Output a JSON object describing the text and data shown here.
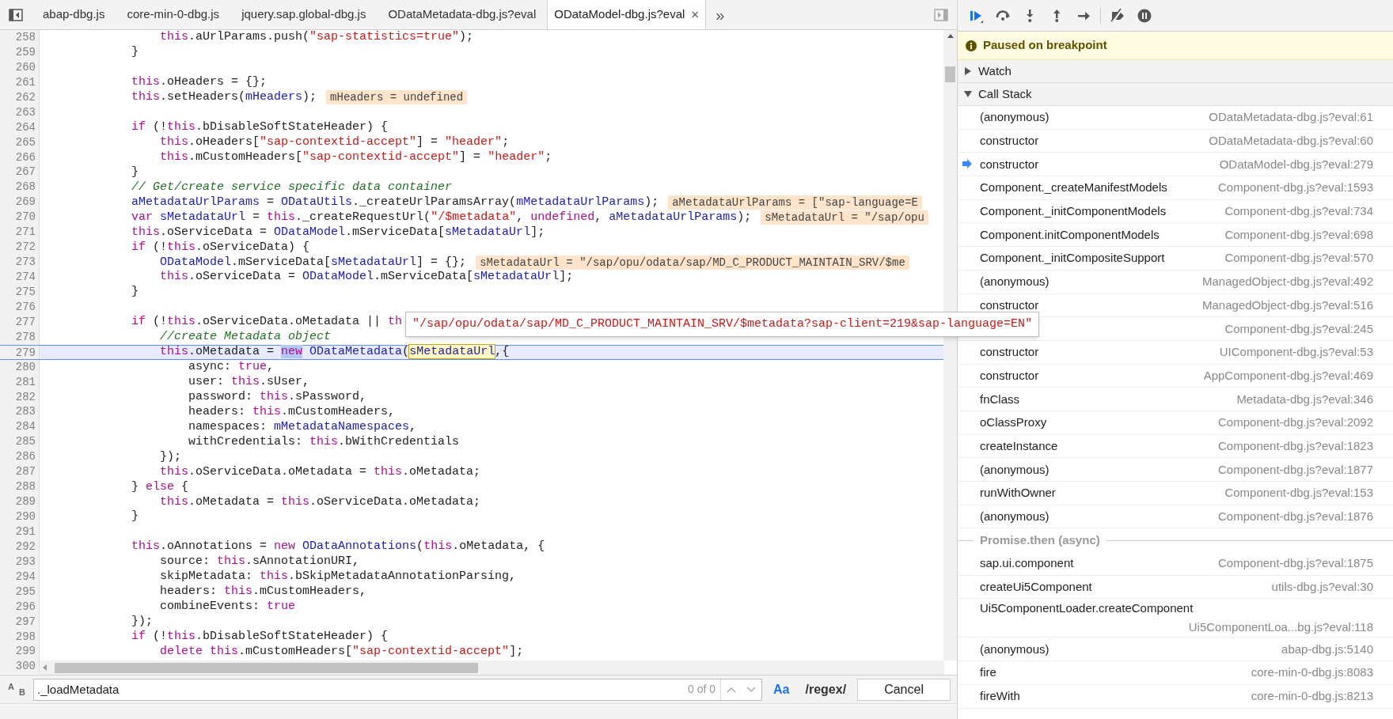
{
  "tabs": [
    {
      "label": "abap-dbg.js",
      "selected": false
    },
    {
      "label": "core-min-0-dbg.js",
      "selected": false
    },
    {
      "label": "jquery.sap.global-dbg.js",
      "selected": false
    },
    {
      "label": "ODataMetadata-dbg.js?eval",
      "selected": false
    },
    {
      "label": "ODataModel-dbg.js?eval",
      "selected": true
    }
  ],
  "tab_overflow": "»",
  "close_glyph": "×",
  "lines": [
    {
      "number": "258",
      "selected": false,
      "tokens": [
        {
          "kind": "keyword",
          "text": "                this"
        },
        {
          "kind": "plain",
          "text": ".aUrlParams.push("
        },
        {
          "kind": "string",
          "text": "\"sap-statistics=true\""
        },
        {
          "kind": "plain",
          "text": ");"
        }
      ]
    },
    {
      "number": "259",
      "selected": false,
      "tokens": [
        {
          "kind": "plain",
          "text": "            }"
        }
      ]
    },
    {
      "number": "260",
      "selected": false
    },
    {
      "number": "261",
      "selected": false,
      "tokens": [
        {
          "kind": "keyword",
          "text": "            this"
        },
        {
          "kind": "plain",
          "text": ".oHeaders = {};"
        }
      ]
    },
    {
      "number": "262",
      "selected": false,
      "tokens": [
        {
          "kind": "keyword",
          "text": "            this"
        },
        {
          "kind": "plain",
          "text": ".setHeaders("
        },
        {
          "kind": "variable",
          "text": "mHeaders"
        },
        {
          "kind": "plain",
          "text": ");"
        }
      ],
      "inline_value": "mHeaders = undefined"
    },
    {
      "number": "263",
      "selected": false
    },
    {
      "number": "264",
      "selected": false,
      "tokens": [
        {
          "kind": "keyword",
          "text": "            if"
        },
        {
          "kind": "plain",
          "text": " (!"
        },
        {
          "kind": "keyword",
          "text": "this"
        },
        {
          "kind": "plain",
          "text": ".bDisableSoftStateHeader) {"
        }
      ]
    },
    {
      "number": "265",
      "selected": false,
      "tokens": [
        {
          "kind": "keyword",
          "text": "                this"
        },
        {
          "kind": "plain",
          "text": ".oHeaders["
        },
        {
          "kind": "string",
          "text": "\"sap-contextid-accept\""
        },
        {
          "kind": "plain",
          "text": "] = "
        },
        {
          "kind": "string",
          "text": "\"header\""
        },
        {
          "kind": "plain",
          "text": ";"
        }
      ]
    },
    {
      "number": "266",
      "selected": false,
      "tokens": [
        {
          "kind": "keyword",
          "text": "                this"
        },
        {
          "kind": "plain",
          "text": ".mCustomHeaders["
        },
        {
          "kind": "string",
          "text": "\"sap-contextid-accept\""
        },
        {
          "kind": "plain",
          "text": "] = "
        },
        {
          "kind": "string",
          "text": "\"header\""
        },
        {
          "kind": "plain",
          "text": ";"
        }
      ]
    },
    {
      "number": "267",
      "selected": false,
      "tokens": [
        {
          "kind": "plain",
          "text": "            }"
        }
      ]
    },
    {
      "number": "268",
      "selected": false,
      "tokens": [
        {
          "kind": "comment",
          "text": "            // Get/create service specific data container"
        }
      ]
    },
    {
      "number": "269",
      "selected": false,
      "tokens": [
        {
          "kind": "variable",
          "text": "            aMetadataUrlParams"
        },
        {
          "kind": "plain",
          "text": " = "
        },
        {
          "kind": "variable",
          "text": "ODataUtils"
        },
        {
          "kind": "plain",
          "text": "._createUrlParamsArray("
        },
        {
          "kind": "variable",
          "text": "mMetadataUrlParams"
        },
        {
          "kind": "plain",
          "text": ");"
        }
      ],
      "inline_value": "aMetadataUrlParams = [\"sap-language=E"
    },
    {
      "number": "270",
      "selected": false,
      "tokens": [
        {
          "kind": "keyword",
          "text": "            var"
        },
        {
          "kind": "variable",
          "text": " sMetadataUrl"
        },
        {
          "kind": "plain",
          "text": " = "
        },
        {
          "kind": "keyword",
          "text": "this"
        },
        {
          "kind": "plain",
          "text": "._createRequestUrl("
        },
        {
          "kind": "string",
          "text": "\"/$metadata\""
        },
        {
          "kind": "plain",
          "text": ", "
        },
        {
          "kind": "keyword",
          "text": "undefined"
        },
        {
          "kind": "plain",
          "text": ", "
        },
        {
          "kind": "variable",
          "text": "aMetadataUrlParams"
        },
        {
          "kind": "plain",
          "text": ");"
        }
      ],
      "inline_value": "sMetadataUrl = \"/sap/opu"
    },
    {
      "number": "271",
      "selected": false,
      "tokens": [
        {
          "kind": "keyword",
          "text": "            this"
        },
        {
          "kind": "plain",
          "text": ".oServiceData = "
        },
        {
          "kind": "variable",
          "text": "ODataModel"
        },
        {
          "kind": "plain",
          "text": ".mServiceData["
        },
        {
          "kind": "variable",
          "text": "sMetadataUrl"
        },
        {
          "kind": "plain",
          "text": "];"
        }
      ]
    },
    {
      "number": "272",
      "selected": false,
      "tokens": [
        {
          "kind": "keyword",
          "text": "            if"
        },
        {
          "kind": "plain",
          "text": " (!"
        },
        {
          "kind": "keyword",
          "text": "this"
        },
        {
          "kind": "plain",
          "text": ".oServiceData) {"
        }
      ]
    },
    {
      "number": "273",
      "selected": false,
      "tokens": [
        {
          "kind": "variable",
          "text": "                ODataModel"
        },
        {
          "kind": "plain",
          "text": ".mServiceData["
        },
        {
          "kind": "variable",
          "text": "sMetadataUrl"
        },
        {
          "kind": "plain",
          "text": "] = {};"
        }
      ],
      "inline_value": "sMetadataUrl = \"/sap/opu/odata/sap/MD_C_PRODUCT_MAINTAIN_SRV/$me"
    },
    {
      "number": "274",
      "selected": false,
      "tokens": [
        {
          "kind": "keyword",
          "text": "                this"
        },
        {
          "kind": "plain",
          "text": ".oServiceData = "
        },
        {
          "kind": "variable",
          "text": "ODataModel"
        },
        {
          "kind": "plain",
          "text": ".mServiceData["
        },
        {
          "kind": "variable",
          "text": "sMetadataUrl"
        },
        {
          "kind": "plain",
          "text": "];"
        }
      ]
    },
    {
      "number": "275",
      "selected": false,
      "tokens": [
        {
          "kind": "plain",
          "text": "            }"
        }
      ]
    },
    {
      "number": "276",
      "selected": false
    },
    {
      "number": "277",
      "selected": false,
      "tokens": [
        {
          "kind": "keyword",
          "text": "            if"
        },
        {
          "kind": "plain",
          "text": " (!"
        },
        {
          "kind": "keyword",
          "text": "this"
        },
        {
          "kind": "plain",
          "text": ".oServiceData.oMetadata || "
        },
        {
          "kind": "keyword",
          "text": "th"
        }
      ]
    },
    {
      "number": "278",
      "selected": false,
      "tokens": [
        {
          "kind": "comment",
          "text": "                //create Metadata object"
        }
      ]
    },
    {
      "number": "279",
      "selected": true,
      "tokens": [
        {
          "kind": "keyword",
          "text": "                this"
        },
        {
          "kind": "plain",
          "text": ".oMetadata = "
        },
        {
          "kind": "selection",
          "text": "new"
        },
        {
          "kind": "variable",
          "text": " ODataMetadata"
        },
        {
          "kind": "plain",
          "text": "("
        },
        {
          "kind": "hover",
          "text": "sMetadataUrl"
        },
        {
          "kind": "plain",
          "text": ",{"
        }
      ]
    },
    {
      "number": "280",
      "selected": false,
      "tokens": [
        {
          "kind": "plain",
          "text": "                    async: "
        },
        {
          "kind": "keyword",
          "text": "true"
        },
        {
          "kind": "plain",
          "text": ","
        }
      ]
    },
    {
      "number": "281",
      "selected": false,
      "tokens": [
        {
          "kind": "plain",
          "text": "                    user: "
        },
        {
          "kind": "keyword",
          "text": "this"
        },
        {
          "kind": "plain",
          "text": ".sUser,"
        }
      ]
    },
    {
      "number": "282",
      "selected": false,
      "tokens": [
        {
          "kind": "plain",
          "text": "                    password: "
        },
        {
          "kind": "keyword",
          "text": "this"
        },
        {
          "kind": "plain",
          "text": ".sPassword,"
        }
      ]
    },
    {
      "number": "283",
      "selected": false,
      "tokens": [
        {
          "kind": "plain",
          "text": "                    headers: "
        },
        {
          "kind": "keyword",
          "text": "this"
        },
        {
          "kind": "plain",
          "text": ".mCustomHeaders,"
        }
      ]
    },
    {
      "number": "284",
      "selected": false,
      "tokens": [
        {
          "kind": "plain",
          "text": "                    namespaces: "
        },
        {
          "kind": "variable",
          "text": "mMetadataNamespaces"
        },
        {
          "kind": "plain",
          "text": ","
        }
      ]
    },
    {
      "number": "285",
      "selected": false,
      "tokens": [
        {
          "kind": "plain",
          "text": "                    withCredentials: "
        },
        {
          "kind": "keyword",
          "text": "this"
        },
        {
          "kind": "plain",
          "text": ".bWithCredentials"
        }
      ]
    },
    {
      "number": "286",
      "selected": false,
      "tokens": [
        {
          "kind": "plain",
          "text": "                });"
        }
      ]
    },
    {
      "number": "287",
      "selected": false,
      "tokens": [
        {
          "kind": "keyword",
          "text": "                this"
        },
        {
          "kind": "plain",
          "text": ".oServiceData.oMetadata = "
        },
        {
          "kind": "keyword",
          "text": "this"
        },
        {
          "kind": "plain",
          "text": ".oMetadata;"
        }
      ]
    },
    {
      "number": "288",
      "selected": false,
      "tokens": [
        {
          "kind": "plain",
          "text": "            } "
        },
        {
          "kind": "keyword",
          "text": "else"
        },
        {
          "kind": "plain",
          "text": " {"
        }
      ]
    },
    {
      "number": "289",
      "selected": false,
      "tokens": [
        {
          "kind": "keyword",
          "text": "                this"
        },
        {
          "kind": "plain",
          "text": ".oMetadata = "
        },
        {
          "kind": "keyword",
          "text": "this"
        },
        {
          "kind": "plain",
          "text": ".oServiceData.oMetadata;"
        }
      ]
    },
    {
      "number": "290",
      "selected": false,
      "tokens": [
        {
          "kind": "plain",
          "text": "            }"
        }
      ]
    },
    {
      "number": "291",
      "selected": false
    },
    {
      "number": "292",
      "selected": false,
      "tokens": [
        {
          "kind": "keyword",
          "text": "            this"
        },
        {
          "kind": "plain",
          "text": ".oAnnotations = "
        },
        {
          "kind": "keyword",
          "text": "new"
        },
        {
          "kind": "variable",
          "text": " ODataAnnotations"
        },
        {
          "kind": "plain",
          "text": "("
        },
        {
          "kind": "keyword",
          "text": "this"
        },
        {
          "kind": "plain",
          "text": ".oMetadata, {"
        }
      ]
    },
    {
      "number": "293",
      "selected": false,
      "tokens": [
        {
          "kind": "plain",
          "text": "                source: "
        },
        {
          "kind": "keyword",
          "text": "this"
        },
        {
          "kind": "plain",
          "text": ".sAnnotationURI,"
        }
      ]
    },
    {
      "number": "294",
      "selected": false,
      "tokens": [
        {
          "kind": "plain",
          "text": "                skipMetadata: "
        },
        {
          "kind": "keyword",
          "text": "this"
        },
        {
          "kind": "plain",
          "text": ".bSkipMetadataAnnotationParsing,"
        }
      ]
    },
    {
      "number": "295",
      "selected": false,
      "tokens": [
        {
          "kind": "plain",
          "text": "                headers: "
        },
        {
          "kind": "keyword",
          "text": "this"
        },
        {
          "kind": "plain",
          "text": ".mCustomHeaders,"
        }
      ]
    },
    {
      "number": "296",
      "selected": false,
      "tokens": [
        {
          "kind": "plain",
          "text": "                combineEvents: "
        },
        {
          "kind": "keyword",
          "text": "true"
        }
      ]
    },
    {
      "number": "297",
      "selected": false,
      "tokens": [
        {
          "kind": "plain",
          "text": "            });"
        }
      ]
    },
    {
      "number": "298",
      "selected": false,
      "tokens": [
        {
          "kind": "keyword",
          "text": "            if"
        },
        {
          "kind": "plain",
          "text": " (!"
        },
        {
          "kind": "keyword",
          "text": "this"
        },
        {
          "kind": "plain",
          "text": ".bDisableSoftStateHeader) {"
        }
      ]
    },
    {
      "number": "299",
      "selected": false,
      "tokens": [
        {
          "kind": "keyword",
          "text": "                delete"
        },
        {
          "kind": "keyword",
          "text": " this"
        },
        {
          "kind": "plain",
          "text": ".mCustomHeaders["
        },
        {
          "kind": "string",
          "text": "\"sap-contextid-accept\""
        },
        {
          "kind": "plain",
          "text": "];"
        }
      ]
    },
    {
      "number": "300",
      "selected": false
    }
  ],
  "tooltip": "\"/sap/opu/odata/sap/MD_C_PRODUCT_MAINTAIN_SRV/$metadata?sap-client=219&sap-language=EN\"",
  "find_bar": {
    "replace_toggle": {
      "top": "A",
      "bottom": "B"
    },
    "value": "._loadMetadata",
    "count": "0 of 0",
    "toggles": [
      {
        "label": "Aa",
        "on": true
      },
      {
        "label": "/regex/",
        "on": false
      }
    ],
    "cancel": "Cancel"
  },
  "debugger": {
    "banner": "Paused on breakpoint",
    "sections": [
      {
        "label": "Watch",
        "expanded": false
      },
      {
        "label": "Call Stack",
        "expanded": true
      }
    ],
    "call_stack": [
      {
        "kind": "frame",
        "name": "(anonymous)",
        "location": "ODataMetadata-dbg.js?eval:61",
        "selected": false
      },
      {
        "kind": "frame",
        "name": "constructor",
        "location": "ODataMetadata-dbg.js?eval:60",
        "selected": false
      },
      {
        "kind": "frame",
        "name": "constructor",
        "location": "ODataModel-dbg.js?eval:279",
        "selected": true
      },
      {
        "kind": "frame",
        "name": "Component._createManifestModels",
        "location": "Component-dbg.js?eval:1593",
        "selected": false
      },
      {
        "kind": "frame",
        "name": "Component._initComponentModels",
        "location": "Component-dbg.js?eval:734",
        "selected": false
      },
      {
        "kind": "frame",
        "name": "Component.initComponentModels",
        "location": "Component-dbg.js?eval:698",
        "selected": false
      },
      {
        "kind": "frame",
        "name": "Component._initCompositeSupport",
        "location": "Component-dbg.js?eval:570",
        "selected": false
      },
      {
        "kind": "frame",
        "name": "(anonymous)",
        "location": "ManagedObject-dbg.js?eval:492",
        "selected": false
      },
      {
        "kind": "frame",
        "name": "constructor",
        "location": "ManagedObject-dbg.js?eval:516",
        "selected": false
      },
      {
        "kind": "frame",
        "location": "Component-dbg.js?eval:245"
      },
      {
        "kind": "frame",
        "name": "constructor",
        "location": "UIComponent-dbg.js?eval:53",
        "selected": false
      },
      {
        "kind": "frame",
        "name": "constructor",
        "location": "AppComponent-dbg.js?eval:469",
        "selected": false
      },
      {
        "kind": "frame",
        "name": "fnClass",
        "location": "Metadata-dbg.js?eval:346",
        "selected": false
      },
      {
        "kind": "frame",
        "name": "oClassProxy",
        "location": "Component-dbg.js?eval:2092",
        "selected": false
      },
      {
        "kind": "frame",
        "name": "createInstance",
        "location": "Component-dbg.js?eval:1823",
        "selected": false
      },
      {
        "kind": "frame",
        "name": "(anonymous)",
        "location": "Component-dbg.js?eval:1877",
        "selected": false
      },
      {
        "kind": "frame",
        "name": "runWithOwner",
        "location": "Component-dbg.js?eval:153",
        "selected": false
      },
      {
        "kind": "frame",
        "name": "(anonymous)",
        "location": "Component-dbg.js?eval:1876",
        "selected": false
      },
      {
        "kind": "async",
        "name": "Promise.then (async)"
      },
      {
        "kind": "frame",
        "name": "sap.ui.component",
        "location": "Component-dbg.js?eval:1875",
        "selected": false
      },
      {
        "kind": "frame",
        "name": "createUi5Component",
        "location": "utils-dbg.js?eval:30",
        "selected": false
      },
      {
        "kind": "frame",
        "name": "Ui5ComponentLoader.createComponent",
        "location": "Ui5ComponentLoa...bg.js?eval:118",
        "selected": false
      },
      {
        "kind": "frame",
        "name": "(anonymous)",
        "location": "abap-dbg.js:5140",
        "selected": false
      },
      {
        "kind": "frame",
        "name": "fire",
        "location": "core-min-0-dbg.js:8083",
        "selected": false
      },
      {
        "kind": "frame",
        "name": "fireWith",
        "location": "core-min-0-dbg.js:8213",
        "selected": false
      }
    ]
  }
}
